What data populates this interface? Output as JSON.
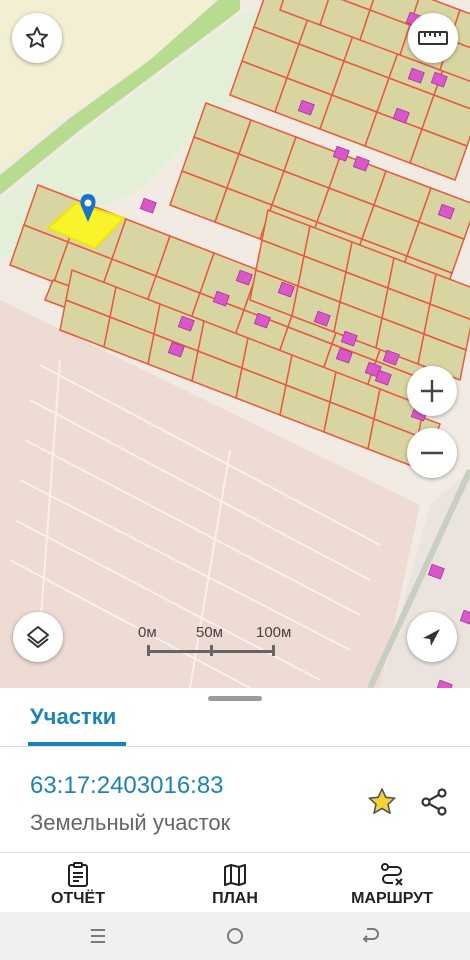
{
  "map": {
    "scale": {
      "labels": [
        "0м",
        "50м",
        "100м"
      ]
    },
    "marker_color": "#1a73c9",
    "selected_parcel_color": "#f8f32b"
  },
  "sheet": {
    "tab_label": "Участки",
    "cadastral_number": "63:17:2403016:83",
    "parcel_type": "Земельный участок",
    "actions": [
      {
        "label": "ОТЧЁТ",
        "icon": "report-icon"
      },
      {
        "label": "ПЛАН",
        "icon": "map-plan-icon"
      },
      {
        "label": "МАРШРУТ",
        "icon": "route-icon"
      }
    ]
  },
  "colors": {
    "accent": "#1b84b5",
    "parcel_fill": "#d9d5a2",
    "parcel_border": "#e8593e",
    "building": "#d957c8"
  }
}
